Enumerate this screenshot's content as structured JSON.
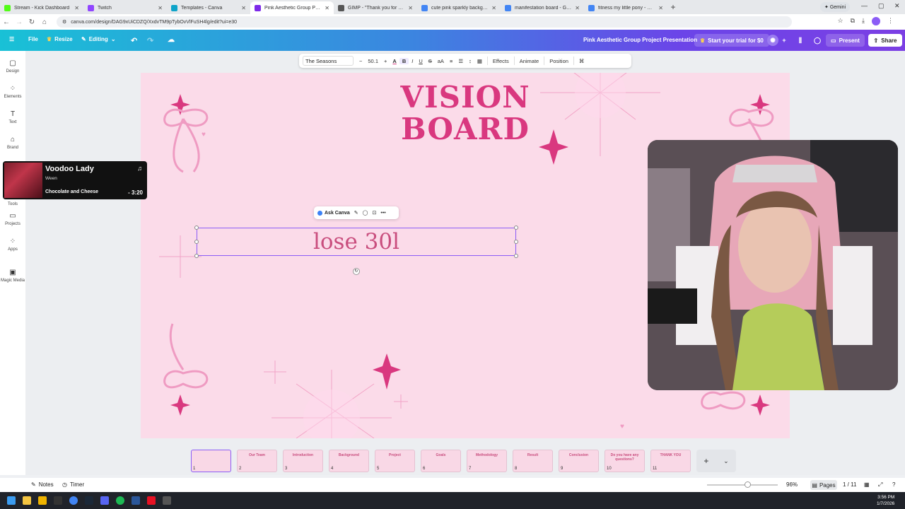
{
  "browser": {
    "tabs": [
      {
        "title": "Stream - Kick Dashboard",
        "color": "#53fc18"
      },
      {
        "title": "Twitch",
        "color": "#9146ff"
      },
      {
        "title": "Templates - Canva",
        "color": "#0fa4c9"
      },
      {
        "title": "Pink Aesthetic Group Project P...",
        "color": "#7d2ae8"
      },
      {
        "title": "GIMP - \"Thank you for your...\"",
        "color": "#555555"
      },
      {
        "title": "cute pink sparkly background...",
        "color": "#4285f4"
      },
      {
        "title": "manifestation board - Google...",
        "color": "#4285f4"
      },
      {
        "title": "fitness my little pony - Google...",
        "color": "#4285f4"
      }
    ],
    "gemini_label": "Gemini",
    "url": "canva.com/design/DAG9xUiCDZQ/XxdvTM9pTybOvVlFuSH4lg/edit?ui=e30"
  },
  "canva": {
    "file_label": "File",
    "resize_label": "Resize",
    "editing_label": "Editing",
    "doc_title": "Pink Aesthetic Group Project Presentation",
    "trial_label": "Start your trial for $0",
    "present_label": "Present",
    "share_label": "Share",
    "rail": [
      {
        "label": "Design",
        "icon": "design-icon"
      },
      {
        "label": "Elements",
        "icon": "elements-icon"
      },
      {
        "label": "Text",
        "icon": "text-icon"
      },
      {
        "label": "Brand",
        "icon": "brand-icon"
      },
      {
        "label": "Tools",
        "icon": "tools-icon"
      },
      {
        "label": "Projects",
        "icon": "folder-icon"
      },
      {
        "label": "Apps",
        "icon": "apps-icon"
      },
      {
        "label": "Magic Media",
        "icon": "magic-media-icon"
      }
    ],
    "format_toolbar": {
      "font": "The Seasons",
      "font_size": "50.1",
      "effects_label": "Effects",
      "animate_label": "Animate",
      "position_label": "Position"
    },
    "mini_toolbar": {
      "ask_label": "Ask Canva"
    },
    "slide": {
      "title_line1": "VISION",
      "title_line2": "BOARD",
      "textbox_text": "lose 30l",
      "accent_color": "#d9387f",
      "background_color": "#fbdbe9"
    },
    "pages": [
      {
        "num": "1",
        "caption": ""
      },
      {
        "num": "2",
        "caption": "Our Team"
      },
      {
        "num": "3",
        "caption": "Introduction"
      },
      {
        "num": "4",
        "caption": "Background"
      },
      {
        "num": "5",
        "caption": "Project"
      },
      {
        "num": "6",
        "caption": "Goals"
      },
      {
        "num": "7",
        "caption": "Methodology"
      },
      {
        "num": "8",
        "caption": "Result"
      },
      {
        "num": "9",
        "caption": "Conclusion"
      },
      {
        "num": "10",
        "caption": "Do you have any questions?"
      },
      {
        "num": "11",
        "caption": "THANK YOU"
      }
    ],
    "bottom": {
      "notes_label": "Notes",
      "timer_label": "Timer",
      "zoom": "96%",
      "pages_label": "Pages",
      "page_counter": "1 / 11"
    }
  },
  "music": {
    "title": "Voodoo Lady",
    "artist": "Ween",
    "album": "Chocolate and Cheese",
    "remaining": "- 3:20"
  },
  "taskbar": {
    "time": "3:56 PM",
    "date": "1/7/2026"
  }
}
